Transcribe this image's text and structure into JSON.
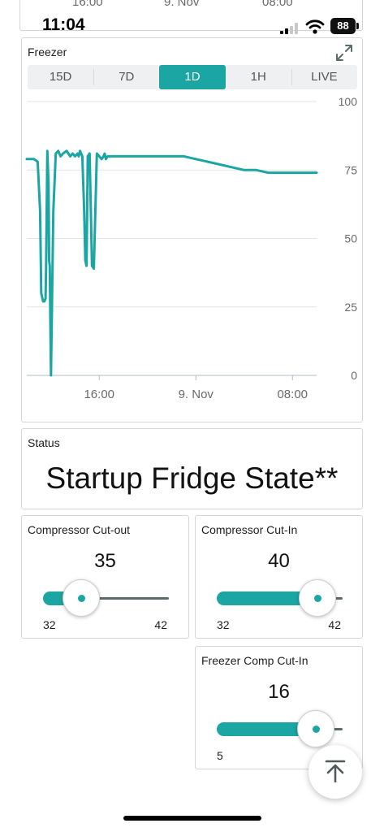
{
  "top_card_peek": {
    "labels": [
      "16:00",
      "9. Nov",
      "08:00"
    ]
  },
  "status_bar": {
    "time": "11:04",
    "battery": "88"
  },
  "chart_card": {
    "title": "Freezer",
    "tabs": [
      {
        "label": "15D",
        "active": false
      },
      {
        "label": "7D",
        "active": false
      },
      {
        "label": "1D",
        "active": true
      },
      {
        "label": "1H",
        "active": false
      },
      {
        "label": "LIVE",
        "active": false
      }
    ]
  },
  "chart_data": {
    "type": "line",
    "title": "Freezer",
    "xlabel": "",
    "ylabel": "",
    "xlim": [
      0,
      24
    ],
    "ylim": [
      0,
      100
    ],
    "yticks": [
      0,
      25,
      50,
      75,
      100
    ],
    "xtick_labels": [
      {
        "x": 6,
        "label": "16:00"
      },
      {
        "x": 14,
        "label": "9. Nov"
      },
      {
        "x": 22,
        "label": "08:00"
      }
    ],
    "grid": true,
    "series_color": "#1ba5a3",
    "series": [
      {
        "name": "",
        "x": [
          0.0,
          0.6,
          0.9,
          1.1,
          1.2,
          1.35,
          1.45,
          1.55,
          1.6,
          1.7,
          1.8,
          1.85,
          1.9,
          1.95,
          2.0,
          2.2,
          2.4,
          2.6,
          2.8,
          3.0,
          3.3,
          3.6,
          3.8,
          4.0,
          4.2,
          4.3,
          4.4,
          4.5,
          4.6,
          4.75,
          4.85,
          4.95,
          5.05,
          5.2,
          5.4,
          5.55,
          5.8,
          6.0,
          6.2,
          6.35,
          6.45,
          6.55,
          6.7,
          6.85,
          7.0,
          8.0,
          9.0,
          10.0,
          11.0,
          12.0,
          13.0,
          14.0,
          15.0,
          16.0,
          17.0,
          18.0,
          19.0,
          20.0,
          21.0,
          21.5,
          22.0,
          22.5,
          23.0,
          23.5,
          23.6,
          23.7,
          23.8,
          23.9,
          24.0
        ],
        "y": [
          79,
          79,
          78,
          60,
          30,
          27,
          27,
          28,
          40,
          82,
          70,
          42,
          40,
          20,
          0,
          60,
          81,
          82,
          80,
          81,
          82,
          80,
          81,
          80,
          81,
          80,
          82,
          81,
          80,
          60,
          42,
          40,
          80,
          81,
          40,
          39,
          81,
          80,
          79,
          80,
          81,
          79,
          80,
          80,
          80,
          80,
          80,
          80,
          80,
          80,
          80,
          79,
          78,
          77,
          76,
          75,
          75,
          74,
          74,
          74,
          74,
          74,
          74,
          74,
          74,
          74,
          74,
          74,
          74
        ]
      }
    ]
  },
  "status_card": {
    "title": "Status",
    "text": "Startup Fridge State**"
  },
  "sliders": [
    {
      "title": "Compressor Cut-out",
      "value": "35",
      "min": "32",
      "max": "42",
      "level": 0.3
    },
    {
      "title": "Compressor Cut-In",
      "value": "40",
      "min": "32",
      "max": "42",
      "level": 0.8
    },
    {
      "title": "Freezer Comp Cut-In",
      "value": "16",
      "min": "5",
      "max": "",
      "level": 0.79
    }
  ]
}
